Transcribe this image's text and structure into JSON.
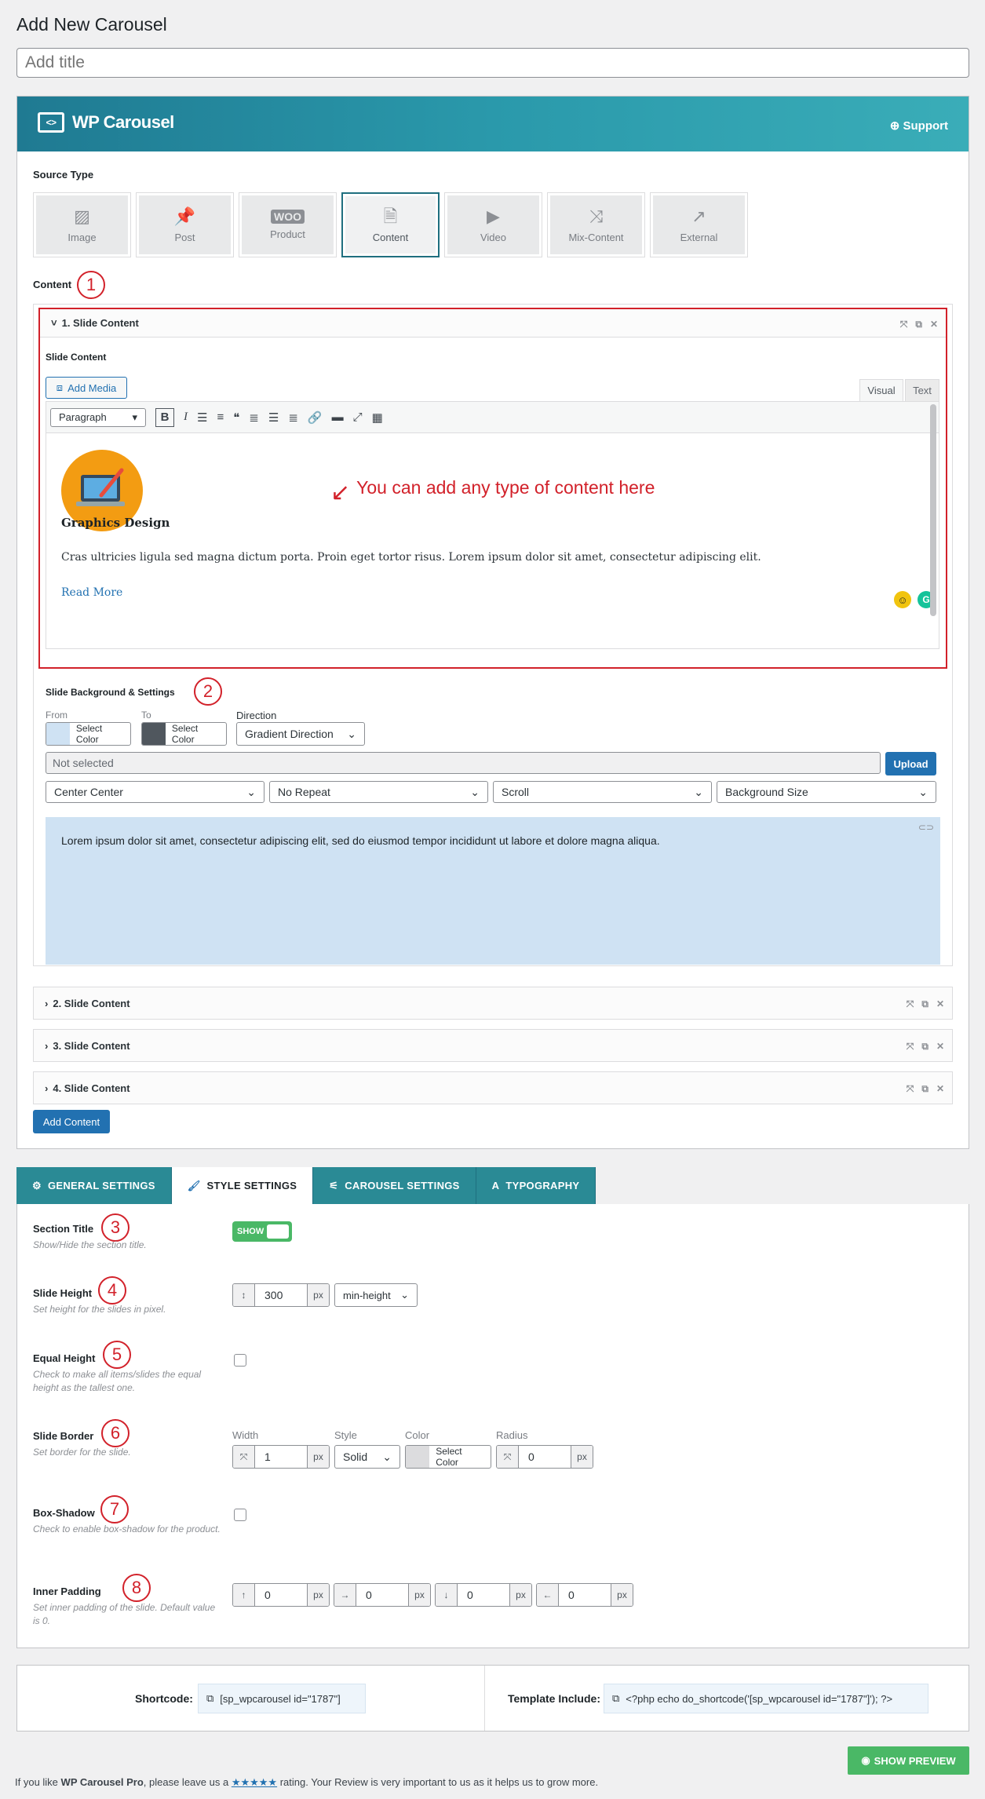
{
  "page": {
    "title": "Add New Carousel",
    "title_placeholder": "Add title"
  },
  "banner": {
    "brand": "WP Carousel",
    "support": "Support"
  },
  "source_type": {
    "label": "Source Type",
    "options": [
      {
        "label": "Image",
        "icon": "image-icon"
      },
      {
        "label": "Post",
        "icon": "pin-icon"
      },
      {
        "label": "Product",
        "icon": "woo-icon"
      },
      {
        "label": "Content",
        "icon": "document-icon"
      },
      {
        "label": "Video",
        "icon": "play-icon"
      },
      {
        "label": "Mix-Content",
        "icon": "shuffle-icon"
      },
      {
        "label": "External",
        "icon": "external-link-icon"
      }
    ],
    "selected": "Content"
  },
  "content": {
    "label": "Content",
    "annotation": "1",
    "slides": [
      {
        "title": "1. Slide Content"
      },
      {
        "title": "2. Slide Content"
      },
      {
        "title": "3. Slide Content"
      },
      {
        "title": "4. Slide Content"
      }
    ],
    "add_button": "Add Content"
  },
  "slide1": {
    "field_label": "Slide Content",
    "add_media": "Add Media",
    "tab_visual": "Visual",
    "tab_text": "Text",
    "paragraph_select": "Paragraph",
    "heading": "Graphics Design",
    "body": "Cras ultricies ligula sed magna dictum porta. Proin eget tortor risus. Lorem ipsum dolor sit amet, consectetur adipiscing elit.",
    "read_more": "Read More",
    "callout": "You can add any type of content here"
  },
  "background": {
    "label": "Slide Background & Settings",
    "annotation": "2",
    "from_label": "From",
    "to_label": "To",
    "direction_label": "Direction",
    "select_color": "Select Color",
    "from_color": "#cfe2f3",
    "to_color": "#50575e",
    "direction": "Gradient Direction",
    "image_value": "Not selected",
    "upload": "Upload",
    "position": "Center Center",
    "repeat": "No Repeat",
    "attachment": "Scroll",
    "size": "Background Size",
    "preview_text": "Lorem ipsum dolor sit amet, consectetur adipiscing elit, sed do eiusmod tempor incididunt ut labore et dolore magna aliqua."
  },
  "tabs": [
    {
      "label": "GENERAL SETTINGS",
      "icon": "gear-icon"
    },
    {
      "label": "STYLE SETTINGS",
      "icon": "brush-icon"
    },
    {
      "label": "CAROUSEL SETTINGS",
      "icon": "sliders-icon"
    },
    {
      "label": "TYPOGRAPHY",
      "icon": "font-icon"
    }
  ],
  "settings": {
    "section_title": {
      "label": "Section Title",
      "desc": "Show/Hide the section title.",
      "toggle": "SHOW",
      "annotation": "3"
    },
    "slide_height": {
      "label": "Slide Height",
      "desc": "Set height for the slides in pixel.",
      "value": "300",
      "unit": "px",
      "mode": "min-height",
      "annotation": "4"
    },
    "equal_height": {
      "label": "Equal Height",
      "desc": "Check to make all items/slides the equal height as the tallest one.",
      "annotation": "5"
    },
    "slide_border": {
      "label": "Slide Border",
      "desc": "Set border for the slide.",
      "annotation": "6",
      "width_label": "Width",
      "style_label": "Style",
      "color_label": "Color",
      "radius_label": "Radius",
      "width": "1",
      "style": "Solid",
      "color_text": "Select Color",
      "radius": "0",
      "unit": "px"
    },
    "box_shadow": {
      "label": "Box-Shadow",
      "desc": "Check to enable box-shadow for the product.",
      "annotation": "7"
    },
    "inner_padding": {
      "label": "Inner Padding",
      "desc": "Set inner padding of the slide. Default value is 0.",
      "annotation": "8",
      "top": "0",
      "right": "0",
      "bottom": "0",
      "left": "0",
      "unit": "px"
    }
  },
  "footer": {
    "shortcode_label": "Shortcode:",
    "shortcode": "[sp_wpcarousel id=\"1787\"]",
    "template_label": "Template Include:",
    "template": "<?php echo do_shortcode('[sp_wpcarousel id=\"1787\"]'); ?>"
  },
  "preview_button": "SHOW PREVIEW",
  "rating": {
    "prefix": "If you like",
    "product": "WP Carousel Pro",
    "middle": ", please leave us a",
    "stars": "★★★★★",
    "suffix": "rating. Your Review is very important to us as it helps us to grow more."
  }
}
